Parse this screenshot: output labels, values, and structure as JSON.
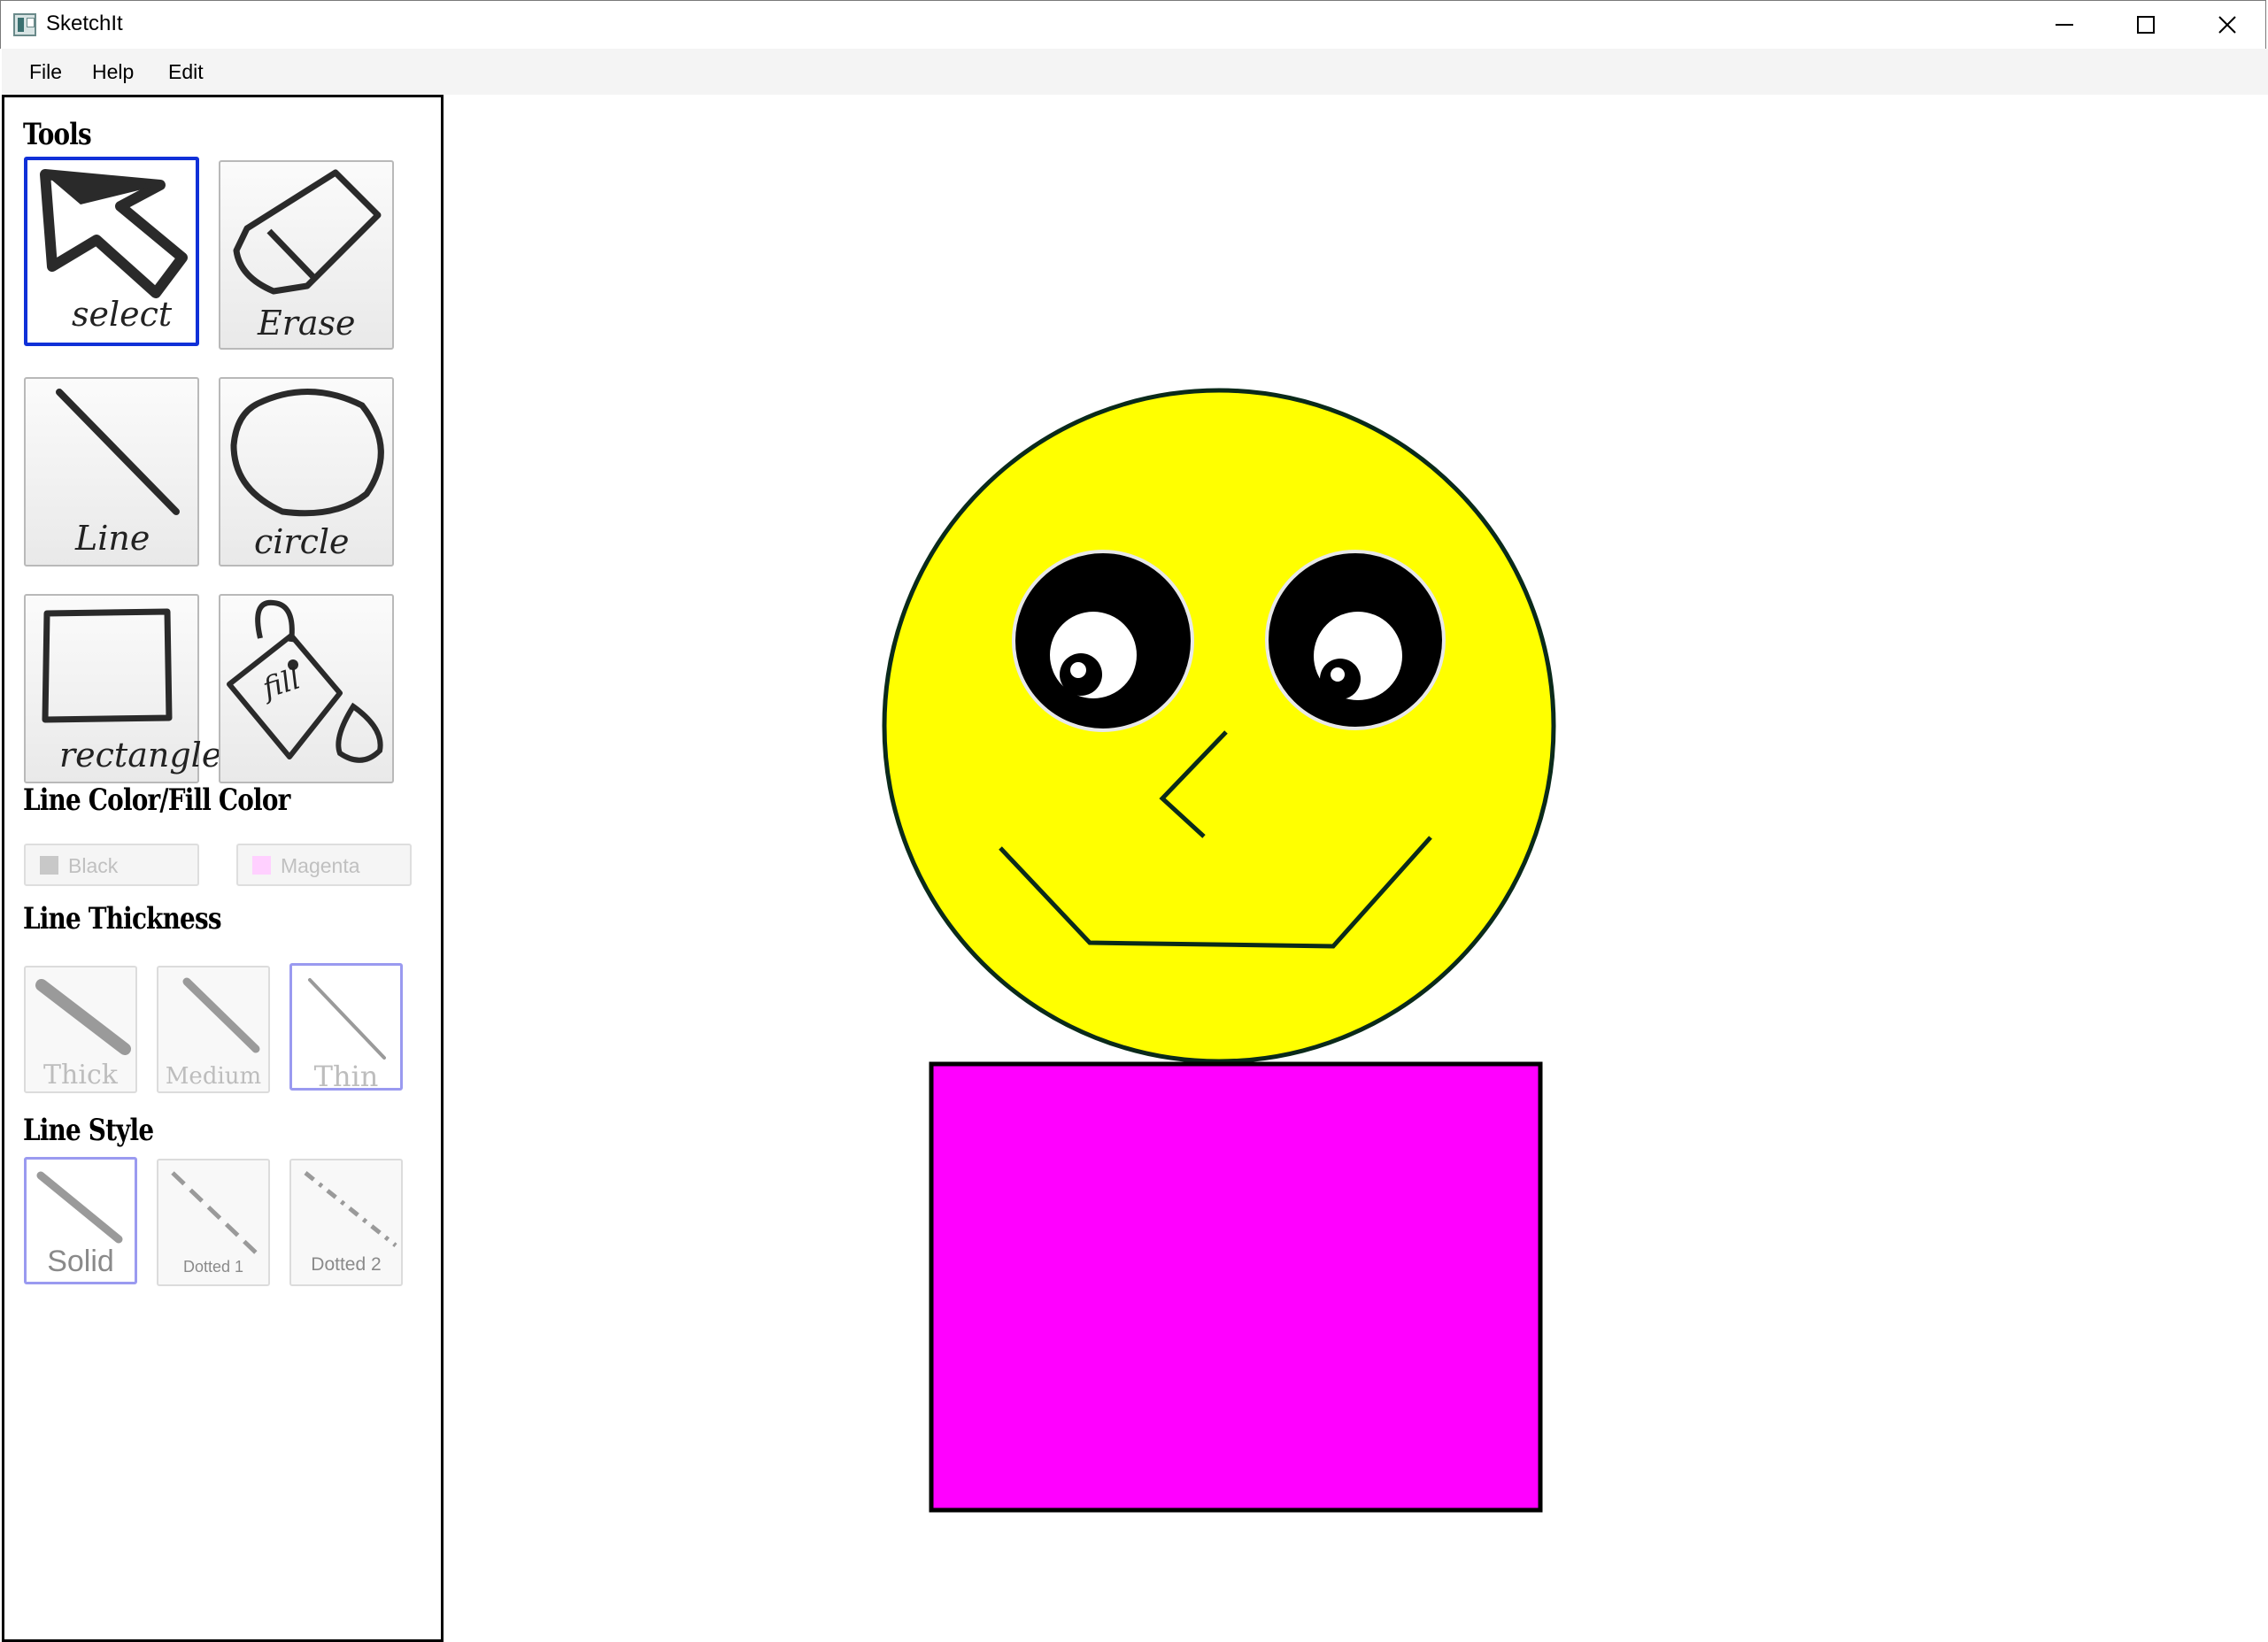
{
  "window": {
    "title": "SketchIt",
    "icon": "app-icon",
    "controls": [
      "minimize-icon",
      "maximize-icon",
      "close-icon"
    ]
  },
  "menu": {
    "items": [
      "File",
      "Help",
      "Edit"
    ]
  },
  "panel": {
    "tools_heading": "Tools",
    "tools": [
      {
        "label": "select",
        "icon": "select-arrow-icon",
        "selected": true
      },
      {
        "label": "Erase",
        "icon": "eraser-icon",
        "selected": false
      },
      {
        "label": "Line",
        "icon": "line-icon",
        "selected": false
      },
      {
        "label": "circle",
        "icon": "circle-icon",
        "selected": false
      },
      {
        "label": "rectangle",
        "icon": "rectangle-icon",
        "selected": false
      },
      {
        "label": "fill",
        "icon": "fill-bucket-icon",
        "selected": false
      }
    ],
    "color_heading": "Line Color/Fill Color",
    "line_color": {
      "label": "Black",
      "swatch": "#c8c8c8"
    },
    "fill_color": {
      "label": "Magenta",
      "swatch": "#ffd0ff"
    },
    "thickness_heading": "Line Thickness",
    "thickness": [
      {
        "label": "Thick",
        "selected": false
      },
      {
        "label": "Medium",
        "selected": false
      },
      {
        "label": "Thin",
        "selected": true
      }
    ],
    "style_heading": "Line Style",
    "styles": [
      {
        "label": "Solid",
        "selected": true
      },
      {
        "label": "Dotted 1",
        "selected": false
      },
      {
        "label": "Dotted 2",
        "selected": false
      }
    ]
  },
  "canvas": {
    "shapes": [
      {
        "kind": "circle",
        "name": "smiley-face-head",
        "fill": "#ffff00",
        "stroke": "#0a2a1a"
      },
      {
        "kind": "circle",
        "name": "left-eye",
        "fill": "#000000",
        "stroke": "#dddddd"
      },
      {
        "kind": "circle",
        "name": "right-eye",
        "fill": "#000000",
        "stroke": "#dddddd"
      },
      {
        "kind": "polyline",
        "name": "nose",
        "stroke": "#0a2a1a"
      },
      {
        "kind": "polyline",
        "name": "mouth",
        "stroke": "#0a2a1a"
      },
      {
        "kind": "rectangle",
        "name": "magenta-body",
        "fill": "#ff00ff",
        "stroke": "#000000"
      }
    ]
  }
}
